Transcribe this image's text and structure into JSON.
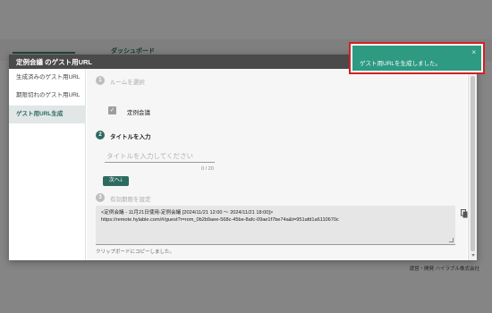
{
  "background": {
    "nav_label": "ダッシュボード",
    "footer_text": "運営・開発 ハイラブル株式会社"
  },
  "modal": {
    "title": "定例会議 のゲスト用URL"
  },
  "sidebar": {
    "items": [
      {
        "label": "生成済みのゲスト用URL"
      },
      {
        "label": "期限切れのゲスト用URL"
      },
      {
        "label": "ゲスト用URL生成"
      }
    ]
  },
  "steps": [
    {
      "number": "1",
      "label": "ルームを選択"
    },
    {
      "number": "2",
      "label": "タイトルを入力"
    },
    {
      "number": "3",
      "label": "有効期限を設定"
    }
  ],
  "room_checkbox": {
    "label": "定例会議",
    "checked": true
  },
  "title_input": {
    "placeholder": "タイトルを入力してください",
    "value": "",
    "counter": "0 / 20"
  },
  "next_button": {
    "label": "次へ"
  },
  "url_output": {
    "line1": "<定例会議 - 11月21日使用-定例会議 [2024/11/21 12:00 ～ 2024/11/21 18:00]>",
    "line2": "https://remote.hylable.com/#/guest?r=rom_0b2b9aee-568c-45be-8afc-09ae1f7be74a&t=951afd1a6110670c"
  },
  "copied_message": "クリップボードにコピーしました。",
  "toast": {
    "message": "ゲスト用URLを生成しました。",
    "close_label": "×"
  },
  "colors": {
    "accent": "#2d6b60",
    "toast": "#2e9a82",
    "highlight_border": "#d32020"
  }
}
